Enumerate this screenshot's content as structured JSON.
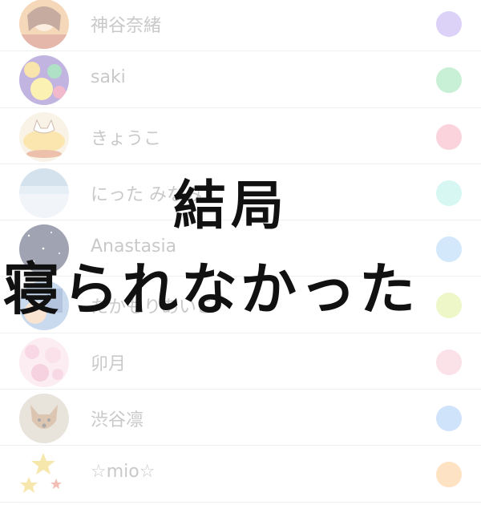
{
  "contacts": [
    {
      "name": "神谷奈緒",
      "dot_color": "#dcd1f7",
      "avatar_icon": "anime-girl-avatar"
    },
    {
      "name": "saki",
      "dot_color": "#c7f0d6",
      "avatar_icon": "colorful-flower-avatar"
    },
    {
      "name": "きょうこ",
      "dot_color": "#fbd3dc",
      "avatar_icon": "omelette-cat-avatar"
    },
    {
      "name": "にった みなみ",
      "dot_color": "#d6f7f2",
      "avatar_icon": "sky-avatar"
    },
    {
      "name": "Anastasia",
      "dot_color": "#d4e8fb",
      "avatar_icon": "night-sky-avatar"
    },
    {
      "name": "たかもりあいこ",
      "dot_color": "#eef7c8",
      "avatar_icon": "blue-photo-avatar"
    },
    {
      "name": "卯月",
      "dot_color": "#fbe1e8",
      "avatar_icon": "cherry-blossom-avatar"
    },
    {
      "name": "渋谷凛",
      "dot_color": "#cfe3fb",
      "avatar_icon": "dog-avatar"
    },
    {
      "name": "☆mio☆",
      "dot_color": "#fde2c3",
      "avatar_icon": "stars-avatar"
    }
  ],
  "overlay": {
    "line1": "結局",
    "line2": "寝られなかった"
  }
}
